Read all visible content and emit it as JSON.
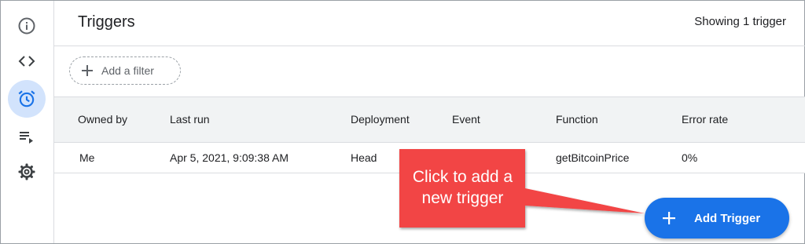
{
  "header": {
    "title": "Triggers",
    "count_text": "Showing 1 trigger"
  },
  "rail": {
    "items": [
      {
        "icon": "info-icon"
      },
      {
        "icon": "code-icon"
      },
      {
        "icon": "alarm-clock-icon",
        "active": true
      },
      {
        "icon": "playlist-play-icon"
      },
      {
        "icon": "gear-icon"
      }
    ]
  },
  "filter": {
    "label": "Add a filter"
  },
  "table": {
    "headers": [
      "Owned by",
      "Last run",
      "Deployment",
      "Event",
      "Function",
      "Error rate"
    ],
    "rows": [
      [
        "Me",
        "Apr 5, 2021, 9:09:38 AM",
        "Head",
        "",
        "getBitcoinPrice",
        "0%"
      ]
    ]
  },
  "callout": {
    "text_line1": "Click to add a",
    "text_line2": "new trigger",
    "color": "#f24444"
  },
  "fab": {
    "label": "Add Trigger",
    "color": "#1a73e8"
  }
}
